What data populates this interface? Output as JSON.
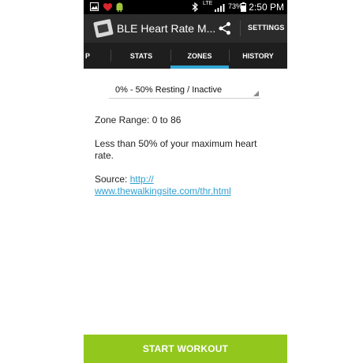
{
  "status_bar": {
    "time": "2:50 PM",
    "battery_percent": "73%",
    "network": "LTE",
    "icons": [
      "image-icon",
      "heart-icon",
      "android-icon",
      "bluetooth-icon",
      "signal-icon",
      "battery-icon"
    ]
  },
  "action_bar": {
    "title": "BLE Heart Rate M...",
    "settings_label": "SETTINGS",
    "icons": [
      "app-icon",
      "share-icon"
    ]
  },
  "tabs": [
    {
      "label": "P"
    },
    {
      "label": "STATS"
    },
    {
      "label": "ZONES",
      "selected": true
    },
    {
      "label": "HISTORY"
    }
  ],
  "zone_select": {
    "value": "0% - 50% Resting / Inactive"
  },
  "content": {
    "zone_range": "Zone Range: 0 to 86",
    "description_line1": "Less than 50% of your maximum heart",
    "description_line2": "rate.",
    "source_label": "Source: ",
    "source_link_line1": "http://",
    "source_link_line2": "www.thewalkingsite.com/thr.html"
  },
  "start_button": {
    "label": "START WORKOUT"
  },
  "colors": {
    "accent": "#33a6d6",
    "start_button": "#92c71d",
    "link": "#2e9fd0",
    "action_bar": "#2b2b2b"
  }
}
